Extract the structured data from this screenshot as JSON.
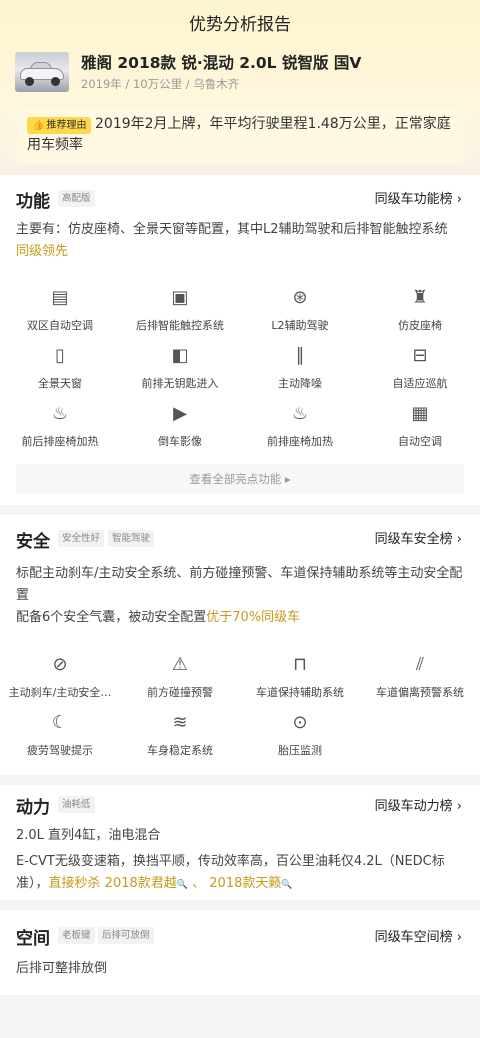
{
  "page": {
    "title": "优势分析报告"
  },
  "car": {
    "name": "雅阁 2018款 锐·混动 2.0L 锐智版 国V",
    "meta": "2019年 / 10万公里 / 乌鲁木齐"
  },
  "reason": {
    "badge": "推荐理由",
    "text": "2019年2月上牌，年平均行驶里程1.48万公里，正常家庭用车频率"
  },
  "function": {
    "title": "功能",
    "tag": "高配版",
    "rank_link": "同级车功能榜 ›",
    "desc": "主要有：仿皮座椅、全景天窗等配置，其中L2辅助驾驶和后排智能触控系统",
    "desc_hl": "同级领先",
    "items": [
      {
        "label": "双区自动空调",
        "icon": "dual-zone-ac-icon"
      },
      {
        "label": "后排智能触控系统",
        "icon": "touch-control-icon"
      },
      {
        "label": "L2辅助驾驶",
        "icon": "steering-wheel-icon"
      },
      {
        "label": "仿皮座椅",
        "icon": "seat-icon"
      },
      {
        "label": "全景天窗",
        "icon": "sunroof-icon"
      },
      {
        "label": "前排无钥匙进入",
        "icon": "car-door-icon"
      },
      {
        "label": "主动降噪",
        "icon": "sound-wave-icon"
      },
      {
        "label": "自适应巡航",
        "icon": "cruise-icon"
      },
      {
        "label": "前后排座椅加热",
        "icon": "seat-heating-icon"
      },
      {
        "label": "倒车影像",
        "icon": "parking-camera-icon"
      },
      {
        "label": "前排座椅加热",
        "icon": "front-seat-heating-icon"
      },
      {
        "label": "自动空调",
        "icon": "auto-ac-icon"
      }
    ],
    "view_all": "查看全部亮点功能 ▸"
  },
  "safety": {
    "title": "安全",
    "tags": [
      "安全性好",
      "智能驾驶"
    ],
    "rank_link": "同级车安全榜 ›",
    "desc1": "标配主动刹车/主动安全系统、前方碰撞预警、车道保持辅助系统等主动安全配置",
    "desc2": "配备6个安全气囊，被动安全配置",
    "desc2_hl": "优于70%同级车",
    "items": [
      {
        "label": "主动刹车/主动安全…",
        "icon": "brake-warning-icon"
      },
      {
        "label": "前方碰撞预警",
        "icon": "collision-warning-icon"
      },
      {
        "label": "车道保持辅助系统",
        "icon": "lane-keep-icon"
      },
      {
        "label": "车道偏离预警系统",
        "icon": "lane-departure-icon"
      },
      {
        "label": "疲劳驾驶提示",
        "icon": "fatigue-icon"
      },
      {
        "label": "车身稳定系统",
        "icon": "stability-icon"
      },
      {
        "label": "胎压监测",
        "icon": "tire-pressure-icon"
      }
    ]
  },
  "power": {
    "title": "动力",
    "tag": "油耗低",
    "rank_link": "同级车动力榜 ›",
    "line1": "2.0L 直列4缸，油电混合",
    "line2": "E-CVT无级变速箱，换挡平顺，传动效率高，百公里油耗仅4.2L（NEDC标准），",
    "line2_hl1": "直接秒杀",
    "line2_link1": "2018款君越",
    "line2_sep": "、",
    "line2_link2": "2018款天籁"
  },
  "space": {
    "title": "空间",
    "tags": [
      "老板键",
      "后排可放倒"
    ],
    "rank_link": "同级车空间榜 ›",
    "desc": "后排可整排放倒"
  }
}
